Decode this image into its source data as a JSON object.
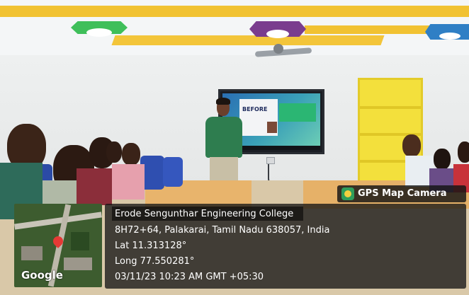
{
  "badge": {
    "app_name": "GPS Map Camera",
    "icon": "gps-map-camera-app-icon"
  },
  "location": {
    "title": "Erode Sengunthar Engineering College",
    "address": "8H72+64, Palakarai, Tamil Nadu 638057, India",
    "latitude": "Lat 11.313128°",
    "longitude": "Long 77.550281°",
    "datetime": "03/11/23 10:23 AM GMT +05:30"
  },
  "map": {
    "brand": "Google",
    "pin_icon": "map-pin-icon"
  },
  "screen": {
    "slide_heading": "BEFORE"
  },
  "colors": {
    "ceiling_accent": "#f2c230",
    "shelf": "#f4e23f",
    "table": "#e9b36a",
    "overlay_bg": "#1c1c1c"
  }
}
